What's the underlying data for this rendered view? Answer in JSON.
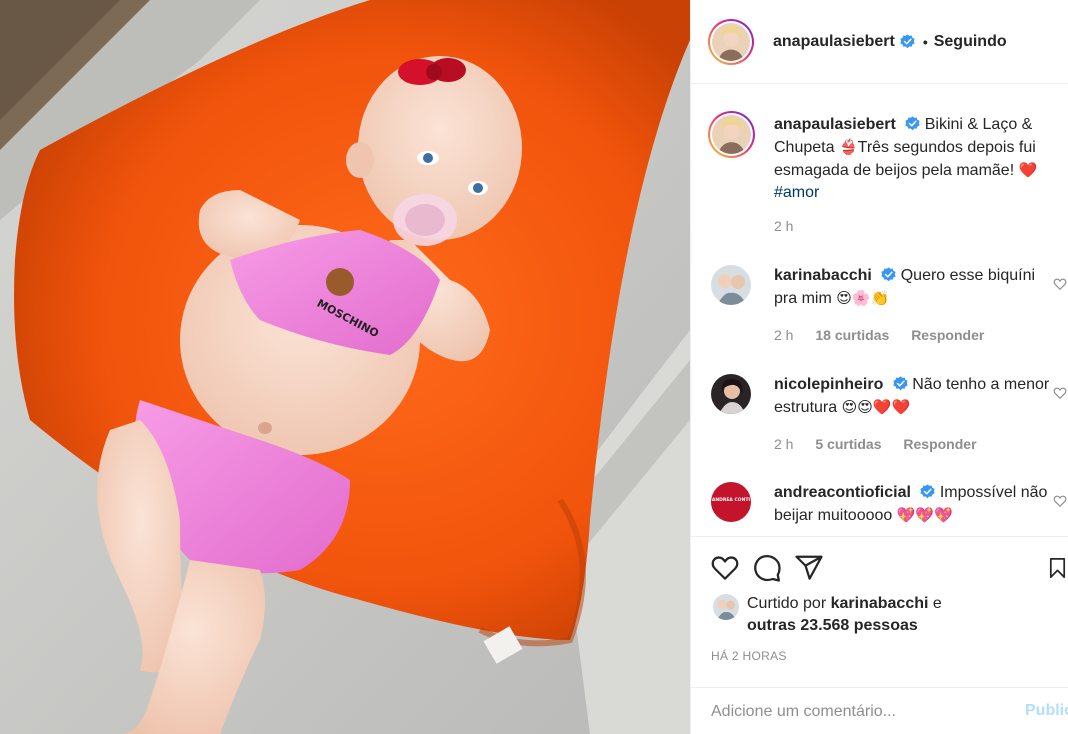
{
  "header": {
    "username": "anapaulasiebert",
    "separator": "•",
    "follow_status": "Seguindo"
  },
  "caption": {
    "username": "anapaulasiebert",
    "text_1": "Bikini & Laço & Chupeta",
    "text_2": "Três segundos depois fui esmagada de beijos pela mamãe!",
    "emoji_bikini": "👙",
    "emoji_heart": "❤️",
    "hashtag": "#amor",
    "time": "2 h"
  },
  "comments": [
    {
      "username": "karinabacchi",
      "text": "Quero esse biquíni pra mim",
      "emojis": "😍🌸👏",
      "time": "2 h",
      "likes": "18 curtidas",
      "reply": "Responder"
    },
    {
      "username": "nicolepinheiro",
      "text": "Não tenho a menor estrutura",
      "emojis": "😍😍❤️❤️",
      "time": "2 h",
      "likes": "5 curtidas",
      "reply": "Responder"
    },
    {
      "username": "andreacontioficial",
      "text": "Impossível não beijar muitooooo",
      "emojis": "💖💖💖",
      "avatar_text": "ANDREA CONTI"
    }
  ],
  "liked_by": {
    "prefix": "Curtido por",
    "user": "karinabacchi",
    "connector": "e",
    "others": "outras 23.568 pessoas"
  },
  "time_ago": "HÁ 2 HORAS",
  "comment_box": {
    "placeholder": "Adicione um comentário...",
    "publish": "Publicar"
  },
  "colors": {
    "verified": "#3897f0",
    "link": "#00376b",
    "secondary_text": "#8e8e8e",
    "publish_disabled": "#b2dffc",
    "divider": "#efefef"
  },
  "icons": [
    "verified-badge-icon",
    "heart-icon",
    "comment-icon",
    "share-icon",
    "bookmark-icon"
  ]
}
